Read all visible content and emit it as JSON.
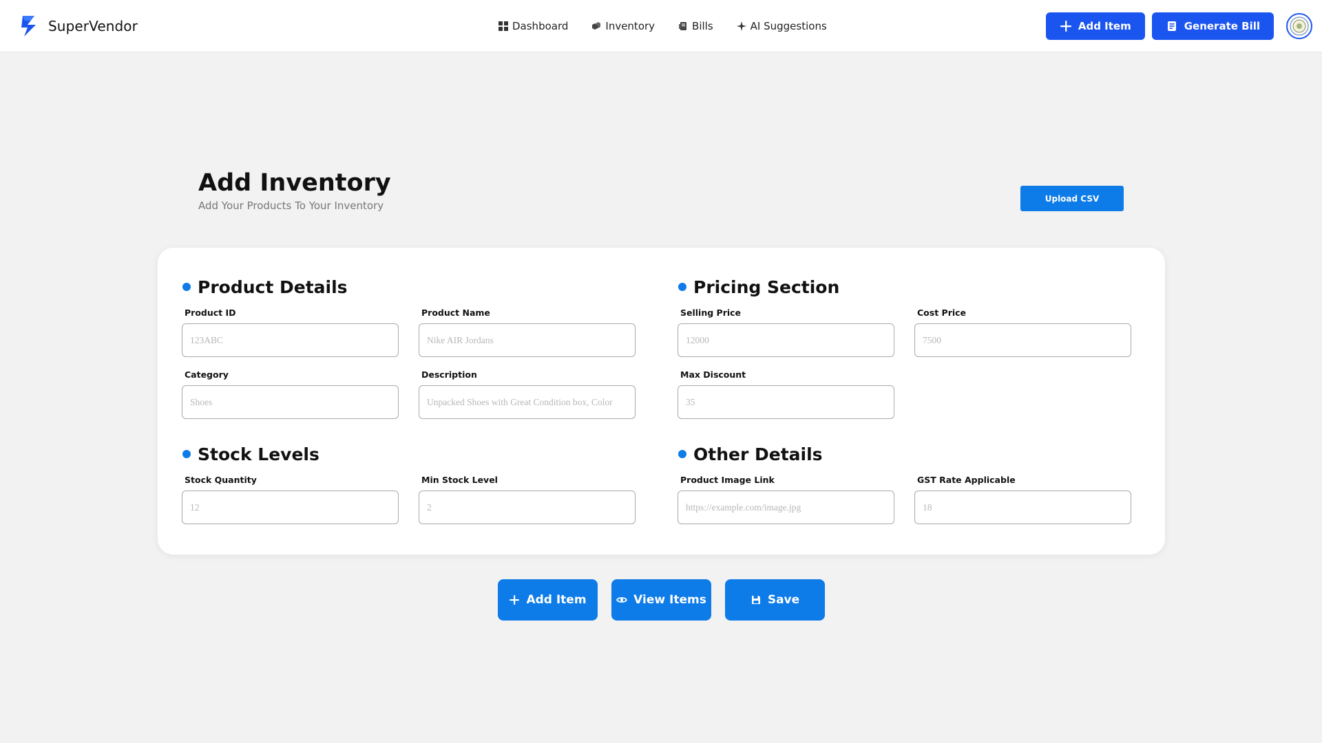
{
  "app": {
    "name": "SuperVendor",
    "brand_icon": "lightning-bolt-icon",
    "accent_color": "#1b55f0",
    "secondary_accent": "#0d7be8"
  },
  "nav": {
    "items": [
      {
        "label": "Dashboard",
        "icon": "grid-icon"
      },
      {
        "label": "Inventory",
        "icon": "boxes-icon"
      },
      {
        "label": "Bills",
        "icon": "receipt-icon"
      },
      {
        "label": "AI Suggestions",
        "icon": "sparkle-icon"
      }
    ]
  },
  "top_actions": {
    "add_item": "Add Item",
    "generate_bill": "Generate Bill"
  },
  "page": {
    "title": "Add Inventory",
    "subtitle": "Add Your Products To Your Inventory",
    "upload_csv": "Upload CSV"
  },
  "sections": {
    "product_details": {
      "title": "Product Details",
      "fields": [
        {
          "label": "Product ID",
          "placeholder": "123ABC"
        },
        {
          "label": "Product Name",
          "placeholder": "Nike AIR Jordans"
        },
        {
          "label": "Category",
          "placeholder": "Shoes"
        },
        {
          "label": "Description",
          "placeholder": "Unpacked Shoes with Great Condition box, Color"
        }
      ]
    },
    "pricing": {
      "title": "Pricing Section",
      "fields": [
        {
          "label": "Selling Price",
          "placeholder": "12000"
        },
        {
          "label": "Cost Price",
          "placeholder": "7500"
        },
        {
          "label": "Max Discount",
          "placeholder": "35"
        }
      ]
    },
    "stock": {
      "title": "Stock Levels",
      "fields": [
        {
          "label": "Stock Quantity",
          "placeholder": "12"
        },
        {
          "label": "Min Stock Level",
          "placeholder": "2"
        }
      ]
    },
    "other": {
      "title": "Other Details",
      "fields": [
        {
          "label": "Product Image Link",
          "placeholder": "https://example.com/image.jpg"
        },
        {
          "label": "GST Rate Applicable",
          "placeholder": "18"
        }
      ]
    }
  },
  "bottom_actions": {
    "add_item": "Add Item",
    "view_items": "View Items",
    "save": "Save"
  }
}
